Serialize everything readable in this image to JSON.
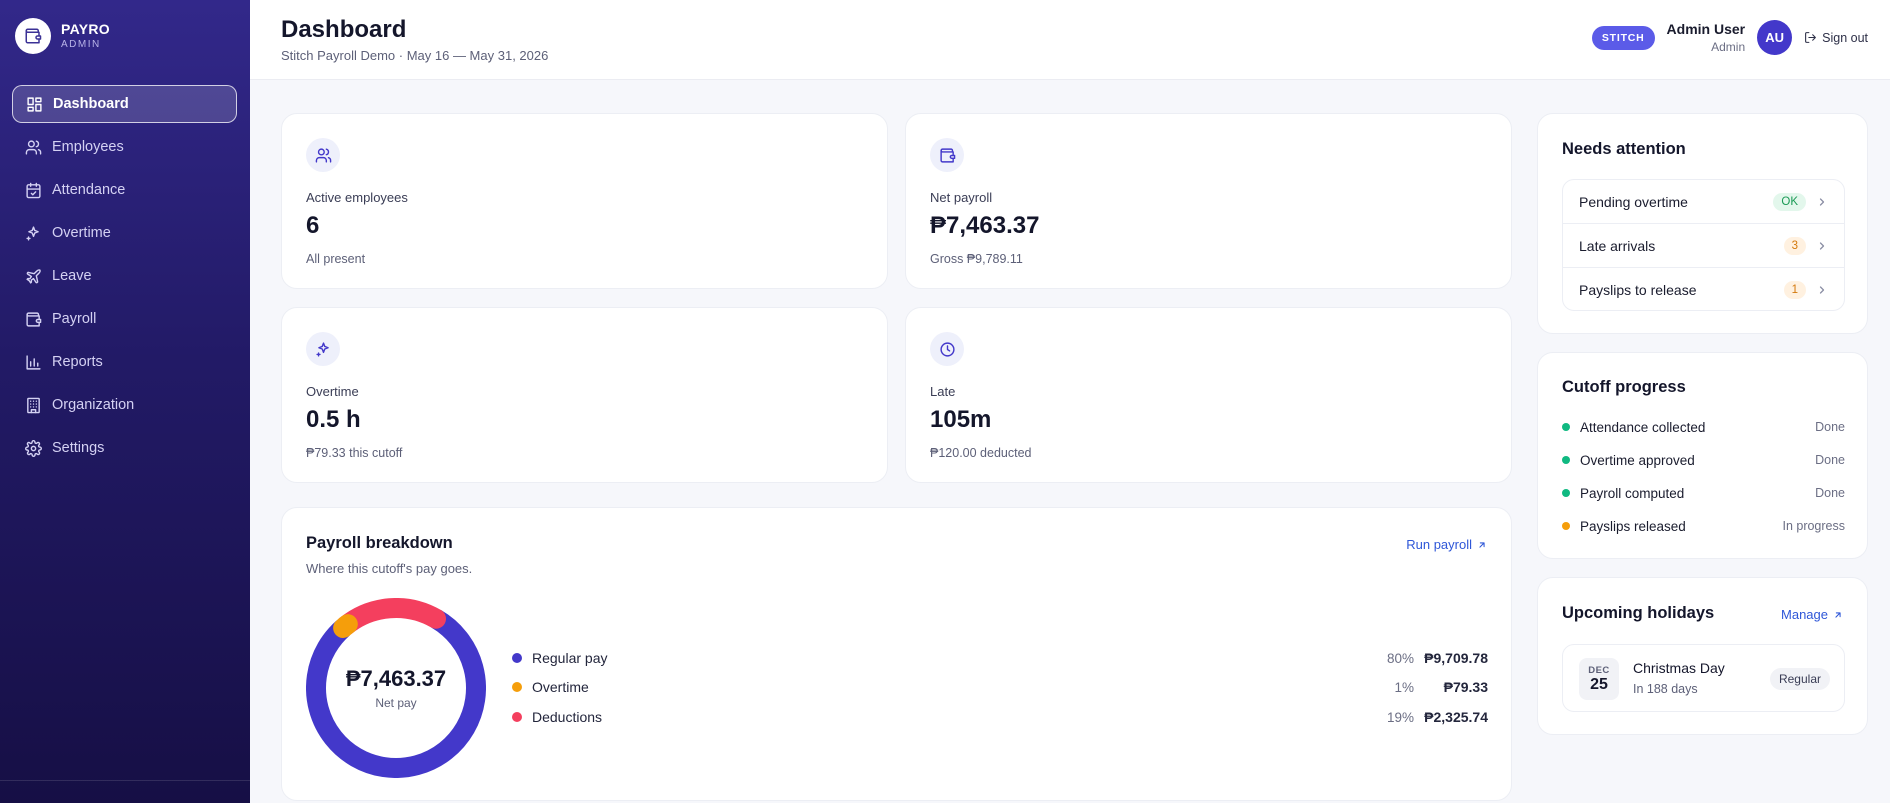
{
  "brand": {
    "name": "PAYRO",
    "role": "ADMIN"
  },
  "sidebar": {
    "items": [
      {
        "label": "Dashboard",
        "icon": "grid-icon",
        "active": true
      },
      {
        "label": "Employees",
        "icon": "users-icon"
      },
      {
        "label": "Attendance",
        "icon": "calendar-check-icon"
      },
      {
        "label": "Overtime",
        "icon": "sparkles-icon"
      },
      {
        "label": "Leave",
        "icon": "plane-icon"
      },
      {
        "label": "Payroll",
        "icon": "wallet-icon"
      },
      {
        "label": "Reports",
        "icon": "bar-chart-icon"
      },
      {
        "label": "Organization",
        "icon": "building-icon"
      },
      {
        "label": "Settings",
        "icon": "gear-icon"
      }
    ]
  },
  "header": {
    "title": "Dashboard",
    "subtitle": "Stitch Payroll Demo · May 16 — May 31, 2026",
    "badge": "STITCH",
    "user_name": "Admin User",
    "user_role": "Admin",
    "avatar_initials": "AU",
    "signout_label": "Sign out"
  },
  "stats": [
    {
      "label": "Active employees",
      "value": "6",
      "note": "All present",
      "icon": "users-icon"
    },
    {
      "label": "Net payroll",
      "value": "₱7,463.37",
      "note": "Gross ₱9,789.11",
      "icon": "wallet-icon"
    },
    {
      "label": "Overtime",
      "value": "0.5 h",
      "note": "₱79.33 this cutoff",
      "icon": "sparkles-icon"
    },
    {
      "label": "Late",
      "value": "105m",
      "note": "₱120.00 deducted",
      "icon": "clock-icon"
    }
  ],
  "breakdown": {
    "title": "Payroll breakdown",
    "subtitle": "Where this cutoff's pay goes.",
    "action_label": "Run payroll",
    "center_value": "₱7,463.37",
    "center_label": "Net pay",
    "chart_data": {
      "type": "pie",
      "categories": [
        "Regular pay",
        "Overtime",
        "Deductions"
      ],
      "values": [
        9709.78,
        79.33,
        2325.74
      ],
      "percent_labels": [
        "80%",
        "1%",
        "19%"
      ],
      "amount_labels": [
        "₱9,709.78",
        "₱79.33",
        "₱2,325.74"
      ],
      "colors": [
        "#4338ca",
        "#f59e0b",
        "#f43f5e"
      ]
    }
  },
  "attention": {
    "title": "Needs attention",
    "items": [
      {
        "label": "Pending overtime",
        "badge": "OK",
        "kind": "ok"
      },
      {
        "label": "Late arrivals",
        "badge": "3",
        "kind": "warn"
      },
      {
        "label": "Payslips to release",
        "badge": "1",
        "kind": "warn"
      }
    ]
  },
  "cutoff": {
    "title": "Cutoff progress",
    "items": [
      {
        "label": "Attendance collected",
        "status": "Done",
        "color": "#10b981"
      },
      {
        "label": "Overtime approved",
        "status": "Done",
        "color": "#10b981"
      },
      {
        "label": "Payroll computed",
        "status": "Done",
        "color": "#10b981"
      },
      {
        "label": "Payslips released",
        "status": "In progress",
        "color": "#f59e0b"
      }
    ]
  },
  "holidays": {
    "title": "Upcoming holidays",
    "action_label": "Manage",
    "items": [
      {
        "month": "DEC",
        "day": "25",
        "name": "Christmas Day",
        "when": "In 188 days",
        "tag": "Regular"
      }
    ]
  }
}
